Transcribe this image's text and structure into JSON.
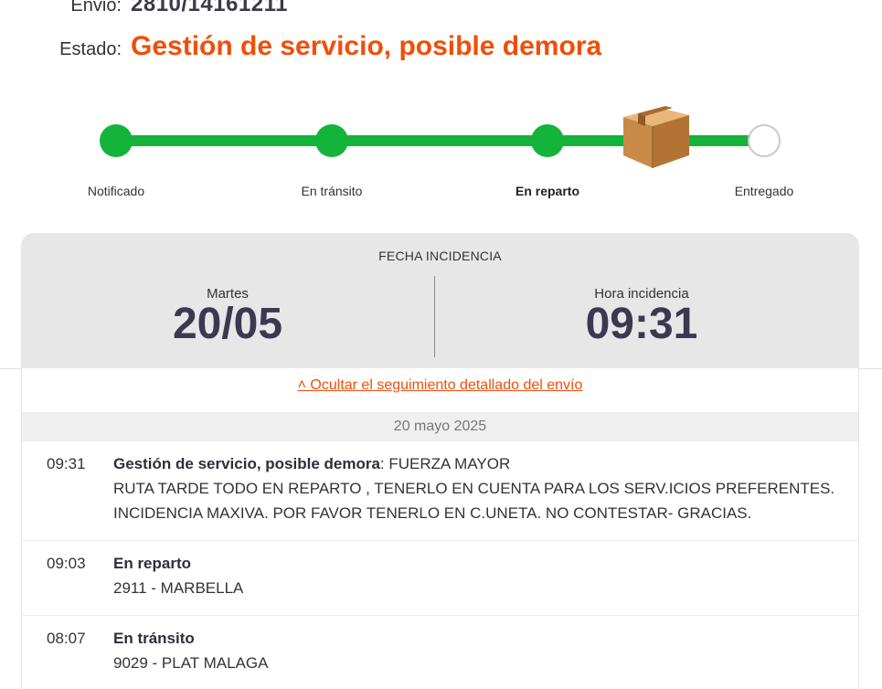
{
  "shipment": {
    "envio_label": "Envio:",
    "envio_value": "2810/14161211",
    "estado_label": "Estado:",
    "estado_value": "Gestión de servicio, posible demora"
  },
  "tracker": {
    "steps": [
      {
        "label": "Notificado",
        "status": "done"
      },
      {
        "label": "En tránsito",
        "status": "done"
      },
      {
        "label": "En reparto",
        "status": "current"
      },
      {
        "label": "Entregado",
        "status": "pending"
      }
    ],
    "current_icon": "package-box-icon",
    "colors": {
      "done": "#14b33a",
      "pending": "#c9c9c9"
    }
  },
  "incidence": {
    "title": "FECHA INCIDENCIA",
    "day_label": "Martes",
    "date": "20/05",
    "hour_label": "Hora incidencia",
    "hour": "09:31"
  },
  "details": {
    "toggle_link": "˄ Ocultar el seguimiento detallado del envío",
    "date_header": "20 mayo 2025",
    "events": [
      {
        "time": "09:31",
        "title": "Gestión de servicio, posible demora",
        "suffix": ": FUERZA MAYOR",
        "lines": [
          "RUTA TARDE TODO EN REPARTO , TENERLO EN CUENTA PARA LOS SERV.ICIOS PREFERENTES.",
          "INCIDENCIA MAXIVA. POR FAVOR TENERLO EN C.UNETA. NO CONTESTAR- GRACIAS."
        ]
      },
      {
        "time": "09:03",
        "title": "En reparto",
        "suffix": "",
        "lines": [
          "2911 - MARBELLA"
        ]
      },
      {
        "time": "08:07",
        "title": "En tránsito",
        "suffix": "",
        "lines": [
          "9029 - PLAT MALAGA"
        ]
      }
    ]
  },
  "colors": {
    "accent": "#f04e0a",
    "progress": "#14b33a",
    "card_bg": "#e7e7e7",
    "big_number": "#3b3850"
  }
}
